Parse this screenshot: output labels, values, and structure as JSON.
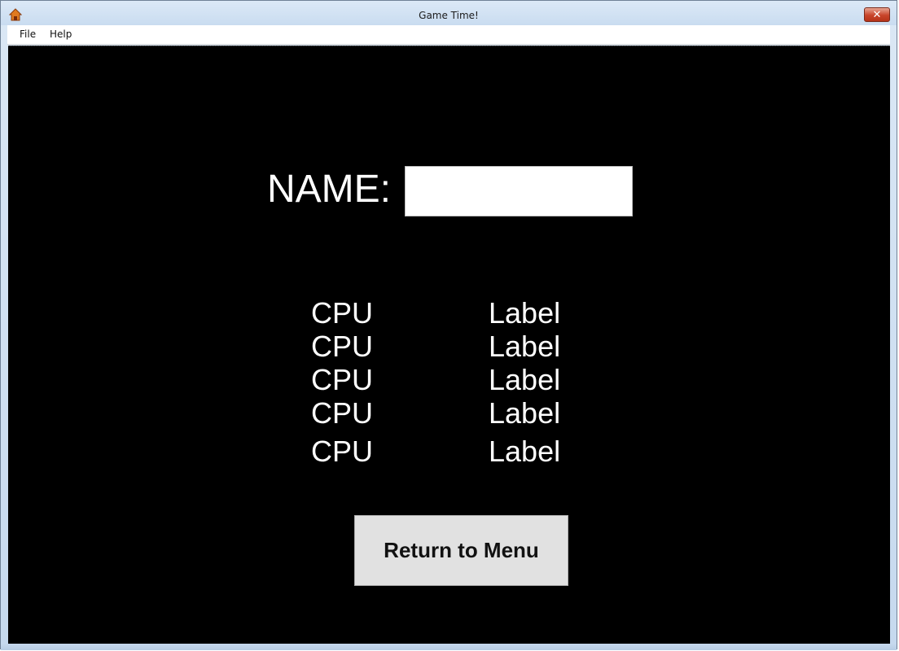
{
  "window": {
    "title": "Game Time!",
    "close_glyph": "✕"
  },
  "menu": {
    "items": [
      "File",
      "Help"
    ]
  },
  "form": {
    "name_label": "NAME:",
    "name_value": ""
  },
  "scores": [
    {
      "player": "CPU",
      "value": "Label"
    },
    {
      "player": "CPU",
      "value": "Label"
    },
    {
      "player": "CPU",
      "value": "Label"
    },
    {
      "player": "CPU",
      "value": "Label"
    },
    {
      "player": "CPU",
      "value": "Label"
    }
  ],
  "actions": {
    "return_label": "Return to Menu"
  },
  "colors": {
    "background": "#000000",
    "text": "#ffffff",
    "button_face": "#e1e1e1"
  }
}
